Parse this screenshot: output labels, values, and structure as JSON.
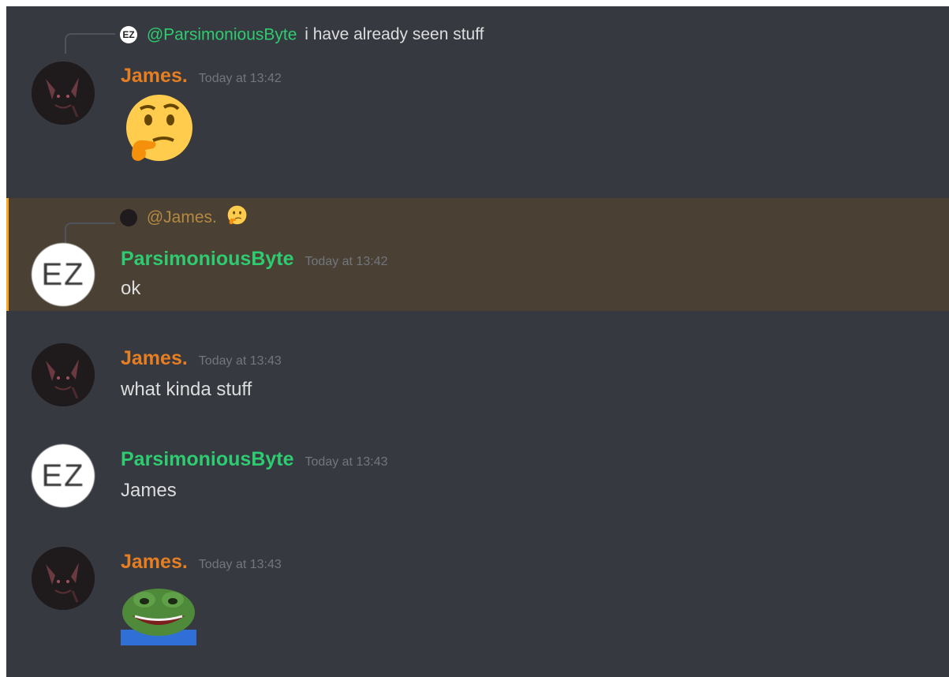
{
  "messages": [
    {
      "author": "James.",
      "timestamp": "Today at 13:42",
      "reply": {
        "mention": "@ParsimoniousByte",
        "text": "i have already seen stuff",
        "avatar_text": "EZ"
      },
      "content": "",
      "emoji": "thinking-face"
    },
    {
      "author": "ParsimoniousByte",
      "timestamp": "Today at 13:42",
      "reply": {
        "mention": "@James.",
        "text": "",
        "emoji": "thinking-face"
      },
      "content": "ok",
      "avatar_text": "EZ",
      "highlighted": true
    },
    {
      "author": "James.",
      "timestamp": "Today at 13:43",
      "content": "what kinda stuff"
    },
    {
      "author": "ParsimoniousByte",
      "timestamp": "Today at 13:43",
      "content": "James",
      "avatar_text": "EZ"
    },
    {
      "author": "James.",
      "timestamp": "Today at 13:43",
      "content": "",
      "emoji": "pepe-laugh-emote"
    }
  ],
  "colors": {
    "background": "#36393f",
    "mention_highlight": "#4a4034",
    "mention_border": "#faa61a",
    "james_name": "#e67e22",
    "parsimonious_name": "#2ecc71",
    "timestamp": "#72767d",
    "text": "#dcddde"
  }
}
